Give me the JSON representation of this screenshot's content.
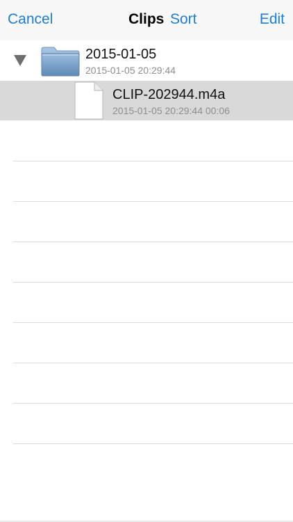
{
  "navbar": {
    "cancel_label": "Cancel",
    "title": "Clips",
    "sort_label": "Sort",
    "edit_label": "Edit",
    "tint_color": "#1a7fd8"
  },
  "folder": {
    "name": "2015-01-05",
    "date": "2015-01-05 20:29:44",
    "expanded": true,
    "icon": "folder-icon",
    "files": [
      {
        "name": "CLIP-202944.m4a",
        "meta": "2015-01-05 20:29:44 00:06",
        "icon": "document-icon",
        "selected": true
      }
    ]
  },
  "empty_rows": 8
}
